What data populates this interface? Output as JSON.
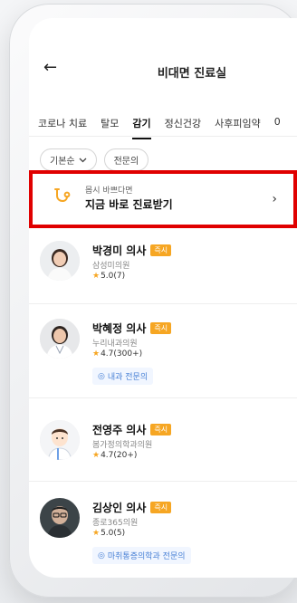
{
  "header": {
    "back_icon": "arrow-left-icon",
    "title": "비대면 진료실"
  },
  "tabs": [
    {
      "label": "코로나 치료",
      "active": false
    },
    {
      "label": "탈모",
      "active": false
    },
    {
      "label": "감기",
      "active": true
    },
    {
      "label": "정신건강",
      "active": false
    },
    {
      "label": "사후피임약",
      "active": false
    },
    {
      "label": "0",
      "active": false
    }
  ],
  "filters": {
    "sort": "기본순",
    "specialist": "전문의"
  },
  "banner": {
    "subtitle": "몹시 바쁘다면",
    "title": "지금 바로 진료받기",
    "icon": "stethoscope-icon"
  },
  "doctors": [
    {
      "name": "박경미 의사",
      "badge": "즉시",
      "hospital": "삼성미의원",
      "rating": "5.0(7)",
      "specialty": ""
    },
    {
      "name": "박혜정 의사",
      "badge": "즉시",
      "hospital": "누리내과의원",
      "rating": "4.7(300+)",
      "specialty": "내과 전문의"
    },
    {
      "name": "전영주 의사",
      "badge": "즉시",
      "hospital": "봄가정의학과의원",
      "rating": "4.7(20+)",
      "specialty": ""
    },
    {
      "name": "김상인 의사",
      "badge": "즉시",
      "hospital": "종로365의원",
      "rating": "5.0(5)",
      "specialty": "마취통증의학과 전문의"
    }
  ],
  "colors": {
    "accent_badge": "#f6a623",
    "highlight_border": "#e00000",
    "specialty_text": "#4a82d6"
  }
}
